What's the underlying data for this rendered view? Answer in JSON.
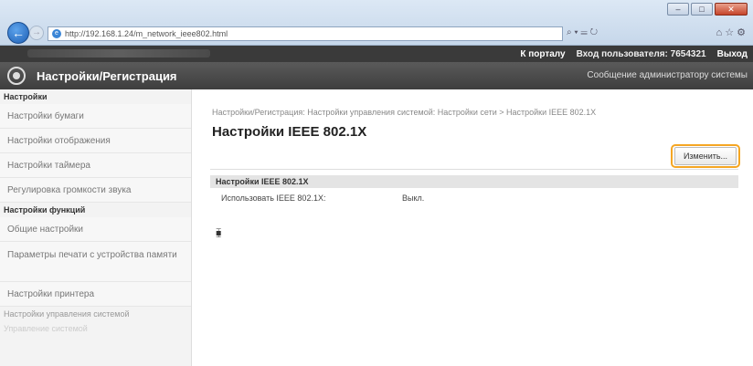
{
  "browser": {
    "url": "http://192.168.1.24/m_network_ieee802.html",
    "address_tools": "⌕ ▾ ☰ ↻",
    "right_tools": "⌂ ☆ ⚙",
    "win_min": "–",
    "win_max": "□",
    "win_close": "✕"
  },
  "topbar": {
    "portal_link": "К порталу",
    "login_label": "Вход пользователя:",
    "login_value": "7654321",
    "logout": "Выход"
  },
  "titlebar": {
    "title": "Настройки/Регистрация",
    "message_admin": "Сообщение администратору системы"
  },
  "sidebar": {
    "section1": "Настройки",
    "items1": [
      "Настройки бумаги",
      "Настройки отображения",
      "Настройки таймера",
      "Регулировка громкости звука"
    ],
    "section2": "Настройки функций",
    "items2": [
      "Общие настройки",
      "Параметры печати с устройства памяти",
      "Настройки принтера"
    ],
    "section3": "Настройки управления системой",
    "section4": "Управление системой"
  },
  "main": {
    "breadcrumb": "Настройки/Регистрация: Настройки управления системой: Настройки сети > Настройки IEEE 802.1X",
    "title": "Настройки IEEE 802.1X",
    "edit_button": "Изменить...",
    "section_title": "Настройки IEEE 802.1X",
    "row_label": "Использовать IEEE 802.1X:",
    "row_value": "Выкл.",
    "top_icon": "⧯"
  }
}
